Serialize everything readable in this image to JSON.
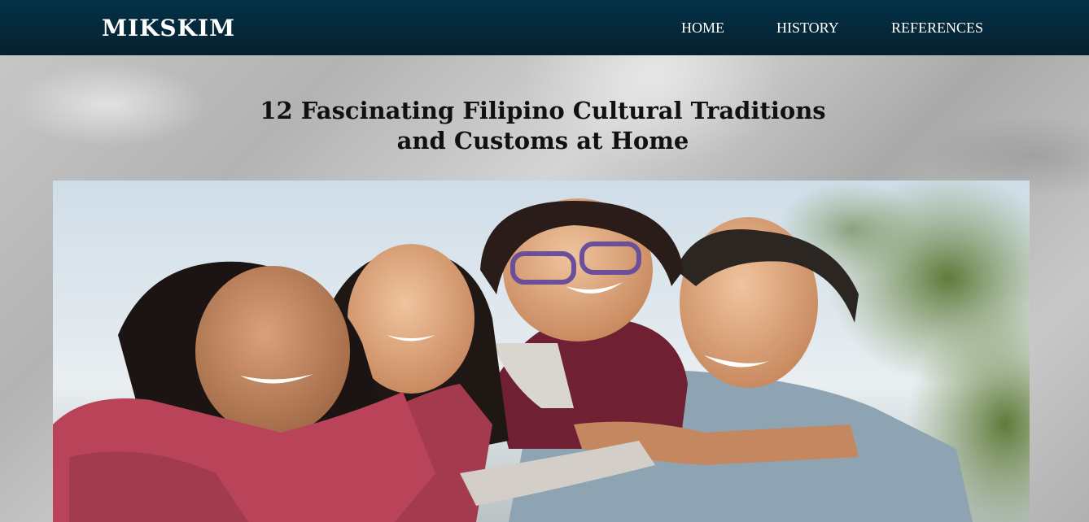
{
  "header": {
    "brand": "MIKSKIM",
    "nav": [
      {
        "label": "HOME"
      },
      {
        "label": "HISTORY"
      },
      {
        "label": "REFERENCES"
      }
    ]
  },
  "main": {
    "title": "12 Fascinating Filipino Cultural Traditions and Customs at Home"
  },
  "colors": {
    "navbar": "#052a3c",
    "nav_text": "#ffffff",
    "title_text": "#111111"
  }
}
